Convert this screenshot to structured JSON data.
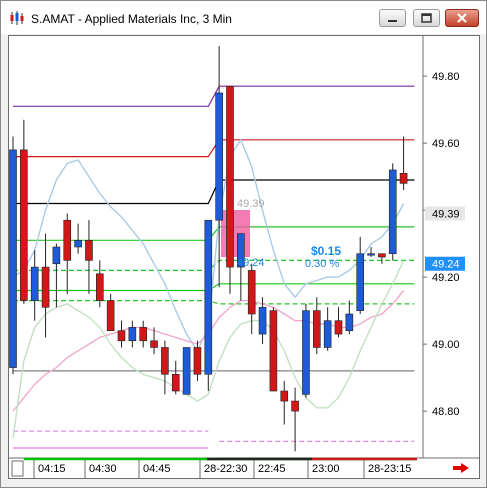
{
  "window": {
    "title": "S.AMAT - Applied Materials Inc, 3 Min",
    "icons": [
      "chart-app-icon",
      "minimize-icon",
      "maximize-icon",
      "close-icon"
    ]
  },
  "chart_data": {
    "type": "candlestick",
    "symbol": "S.AMAT",
    "interval": "3 Min",
    "ylim": [
      48.66,
      49.92
    ],
    "y_ticks": [
      "49.80",
      "49.60",
      "49.40",
      "49.20",
      "49.00",
      "48.80"
    ],
    "x_ticks": [
      "04:15",
      "04:30",
      "04:45",
      "28-22:30",
      "22:45",
      "23:00",
      "28-23:15"
    ],
    "price_labels": [
      {
        "text": "49.39",
        "value": 49.39,
        "bg": "#e6e6e6",
        "fg": "#000000"
      },
      {
        "text": "49.24",
        "value": 49.24,
        "bg": "#1e90ff",
        "fg": "#ffffff"
      }
    ],
    "overlay_labels": {
      "ghost_price": "49.39",
      "blue_price": "49.24",
      "change": "$0.15",
      "change_pct": "0.30 %"
    },
    "candles": [
      {
        "o": 48.93,
        "h": 49.62,
        "l": 48.91,
        "c": 49.58
      },
      {
        "o": 49.58,
        "h": 49.67,
        "l": 49.12,
        "c": 49.13
      },
      {
        "o": 49.13,
        "h": 49.28,
        "l": 49.07,
        "c": 49.23
      },
      {
        "o": 49.23,
        "h": 49.33,
        "l": 49.02,
        "c": 49.11
      },
      {
        "o": 49.24,
        "h": 49.3,
        "l": 49.11,
        "c": 49.29
      },
      {
        "o": 49.37,
        "h": 49.39,
        "l": 49.15,
        "c": 49.25
      },
      {
        "o": 49.29,
        "h": 49.36,
        "l": 49.27,
        "c": 49.31
      },
      {
        "o": 49.31,
        "h": 49.37,
        "l": 49.15,
        "c": 49.25
      },
      {
        "o": 49.21,
        "h": 49.25,
        "l": 49.11,
        "c": 49.13
      },
      {
        "o": 49.13,
        "h": 49.15,
        "l": 49.04,
        "c": 49.04
      },
      {
        "o": 49.04,
        "h": 49.07,
        "l": 48.99,
        "c": 49.01
      },
      {
        "o": 49.01,
        "h": 49.07,
        "l": 48.99,
        "c": 49.05
      },
      {
        "o": 49.05,
        "h": 49.07,
        "l": 48.99,
        "c": 49.01
      },
      {
        "o": 49.01,
        "h": 49.05,
        "l": 48.97,
        "c": 48.99
      },
      {
        "o": 48.99,
        "h": 49.01,
        "l": 48.85,
        "c": 48.91
      },
      {
        "o": 48.91,
        "h": 48.95,
        "l": 48.85,
        "c": 48.86
      },
      {
        "o": 48.85,
        "h": 48.99,
        "l": 48.85,
        "c": 48.99
      },
      {
        "o": 48.99,
        "h": 49.01,
        "l": 48.89,
        "c": 48.91
      },
      {
        "o": 48.91,
        "h": 49.36,
        "l": 48.86,
        "c": 49.37
      },
      {
        "o": 49.37,
        "h": 49.89,
        "l": 49.17,
        "c": 49.75
      },
      {
        "o": 49.77,
        "h": 49.77,
        "l": 49.15,
        "c": 49.23
      },
      {
        "o": 49.23,
        "h": 49.33,
        "l": 49.13,
        "c": 49.33
      },
      {
        "o": 49.22,
        "h": 49.24,
        "l": 49.03,
        "c": 49.09
      },
      {
        "o": 49.03,
        "h": 49.14,
        "l": 49.0,
        "c": 49.11
      },
      {
        "o": 49.1,
        "h": 49.11,
        "l": 48.86,
        "c": 48.86
      },
      {
        "o": 48.86,
        "h": 48.89,
        "l": 48.76,
        "c": 48.83
      },
      {
        "o": 48.83,
        "h": 48.87,
        "l": 48.68,
        "c": 48.8
      },
      {
        "o": 48.85,
        "h": 49.12,
        "l": 48.84,
        "c": 49.1
      },
      {
        "o": 49.1,
        "h": 49.14,
        "l": 48.97,
        "c": 48.99
      },
      {
        "o": 48.99,
        "h": 49.11,
        "l": 48.98,
        "c": 49.07
      },
      {
        "o": 49.07,
        "h": 49.11,
        "l": 49.02,
        "c": 49.03
      },
      {
        "o": 49.04,
        "h": 49.13,
        "l": 49.03,
        "c": 49.09
      },
      {
        "o": 49.1,
        "h": 49.32,
        "l": 49.09,
        "c": 49.27
      },
      {
        "o": 49.27,
        "h": 49.29,
        "l": 49.26,
        "c": 49.27
      },
      {
        "o": 49.27,
        "h": 49.26,
        "l": 49.24,
        "c": 49.26
      },
      {
        "o": 49.27,
        "h": 49.54,
        "l": 49.25,
        "c": 49.52
      },
      {
        "o": 49.51,
        "h": 49.62,
        "l": 49.46,
        "c": 49.48
      }
    ],
    "levels": [
      {
        "color": "#7b2c9c",
        "dash": false,
        "pts": [
          [
            0,
            49.71
          ],
          [
            18,
            49.71
          ],
          [
            19,
            49.77
          ],
          [
            37,
            49.77
          ]
        ]
      },
      {
        "color": "#d01818",
        "dash": false,
        "pts": [
          [
            0,
            49.56
          ],
          [
            18,
            49.56
          ],
          [
            19,
            49.61
          ],
          [
            37,
            49.61
          ]
        ]
      },
      {
        "color": "#000000",
        "dash": false,
        "pts": [
          [
            0,
            49.42
          ],
          [
            18,
            49.42
          ],
          [
            19,
            49.49
          ],
          [
            37,
            49.49
          ]
        ]
      },
      {
        "color": "#27c427",
        "dash": false,
        "pts": [
          [
            0,
            49.31
          ],
          [
            18,
            49.31
          ],
          [
            19,
            49.35
          ],
          [
            37,
            49.35
          ]
        ]
      },
      {
        "color": "#27c427",
        "dash": true,
        "pts": [
          [
            0,
            49.22
          ],
          [
            18,
            49.22
          ],
          [
            19,
            49.25
          ],
          [
            37,
            49.25
          ]
        ]
      },
      {
        "color": "#15c815",
        "dash": false,
        "pts": [
          [
            0,
            49.16
          ],
          [
            18,
            49.16
          ],
          [
            19,
            49.18
          ],
          [
            37,
            49.18
          ]
        ]
      },
      {
        "color": "#27c427",
        "dash": true,
        "pts": [
          [
            0,
            49.13
          ],
          [
            18,
            49.13
          ],
          [
            19,
            49.12
          ],
          [
            37,
            49.12
          ]
        ]
      },
      {
        "color": "#808080",
        "dash": false,
        "pts": [
          [
            0,
            48.92
          ],
          [
            37,
            48.92
          ]
        ]
      },
      {
        "color": "#e080e0",
        "dash": true,
        "pts": [
          [
            0,
            48.74
          ],
          [
            18,
            48.74
          ]
        ]
      },
      {
        "color": "#e080e0",
        "dash": true,
        "pts": [
          [
            19,
            48.71
          ],
          [
            37,
            48.71
          ]
        ]
      },
      {
        "color": "#e080e0",
        "dash": false,
        "pts": [
          [
            0,
            48.69
          ],
          [
            18,
            48.69
          ]
        ]
      },
      {
        "color": "#e080e0",
        "dash": false,
        "pts": [
          [
            19,
            48.66
          ],
          [
            37,
            48.66
          ]
        ]
      }
    ],
    "bands": [
      {
        "color": "#a9cbe8",
        "vals": [
          49.2,
          49.22,
          49.28,
          49.4,
          49.49,
          49.54,
          49.55,
          49.5,
          49.45,
          49.41,
          49.38,
          49.34,
          49.3,
          49.24,
          49.18,
          49.1,
          49.03,
          48.98,
          49.05,
          49.38,
          49.56,
          49.61,
          49.53,
          49.4,
          49.28,
          49.18,
          49.14,
          49.18,
          49.19,
          49.2,
          49.2,
          49.22,
          49.25,
          49.3,
          49.32,
          49.36,
          49.42
        ]
      },
      {
        "color": "#f2a9cf",
        "vals": [
          48.8,
          48.84,
          48.88,
          48.91,
          48.93,
          48.96,
          48.98,
          49.0,
          49.02,
          49.03,
          49.04,
          49.05,
          49.05,
          49.04,
          49.03,
          49.02,
          49.01,
          49.0,
          49.03,
          49.08,
          49.11,
          49.13,
          49.13,
          49.12,
          49.11,
          49.09,
          49.07,
          49.07,
          49.06,
          49.06,
          49.05,
          49.05,
          49.06,
          49.08,
          49.09,
          49.12,
          49.16
        ]
      },
      {
        "color": "#c2e0c2",
        "vals": [
          48.72,
          48.95,
          49.05,
          49.09,
          49.11,
          49.12,
          49.1,
          49.08,
          49.05,
          49.0,
          48.96,
          48.93,
          48.91,
          48.9,
          48.89,
          48.87,
          48.85,
          48.83,
          48.85,
          48.95,
          49.02,
          49.06,
          49.07,
          49.07,
          49.04,
          48.98,
          48.9,
          48.84,
          48.81,
          48.81,
          48.84,
          48.9,
          48.98,
          49.05,
          49.12,
          49.18,
          49.25
        ]
      }
    ]
  },
  "scroll": {
    "arrow_color": "#e00000"
  }
}
